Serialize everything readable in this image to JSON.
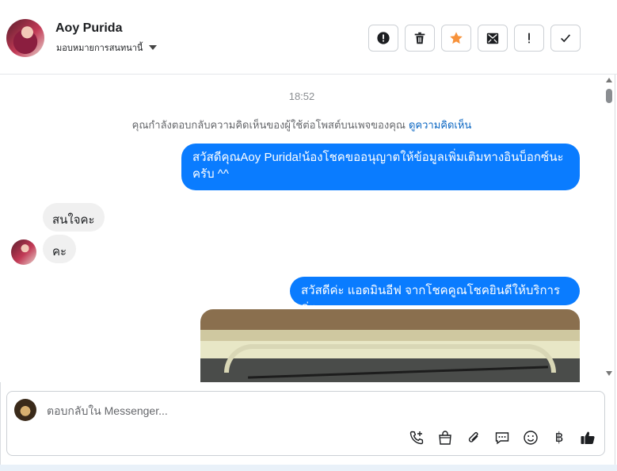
{
  "header": {
    "contact_name": "Aoy Purida",
    "assign_label": "มอบหมายการสนทนานี้",
    "tools": [
      {
        "icon": "alert-circle-icon",
        "name": "mark-spam-button"
      },
      {
        "icon": "trash-icon",
        "name": "delete-button"
      },
      {
        "icon": "star-icon",
        "name": "star-button",
        "color": "#f7923b"
      },
      {
        "icon": "mark-unread-icon",
        "name": "mark-unread-button"
      },
      {
        "icon": "exclamation-icon",
        "name": "follow-up-button"
      },
      {
        "icon": "check-icon",
        "name": "mark-done-button"
      }
    ]
  },
  "conversation": {
    "timestamp": "18:52",
    "notice_text": "คุณกำลังตอบกลับความคิดเห็นของผู้ใช้ต่อโพสต์บนเพจของคุณ",
    "notice_link": "ดูความคิดเห็น",
    "messages": [
      {
        "from": "page",
        "text": "สวัสดีคุณAoy Purida!น้องโชคขออนุญาตให้ข้อมูลเพิ่มเติมทางอินบ็อกซ์นะครับ ^^"
      },
      {
        "from": "user",
        "text": "สนใจคะ"
      },
      {
        "from": "user",
        "text": "คะ"
      },
      {
        "from": "page",
        "text": "สวัสดีค่ะ แอดมินอีฟ จากโชคคูณโชคยินดีให้บริการค่ะ"
      },
      {
        "from": "page",
        "type": "image"
      }
    ]
  },
  "composer": {
    "placeholder": "ตอบกลับใน Messenger...",
    "actions": [
      "call-add-icon",
      "shopping-bag-icon",
      "paperclip-icon",
      "saved-reply-icon",
      "emoji-icon",
      "baht-icon",
      "like-icon"
    ],
    "baht_symbol": "฿"
  },
  "colors": {
    "accent": "#0a7cff",
    "link": "#0a66c2",
    "star": "#f7923b",
    "incoming_bubble": "#f0f0f0"
  }
}
